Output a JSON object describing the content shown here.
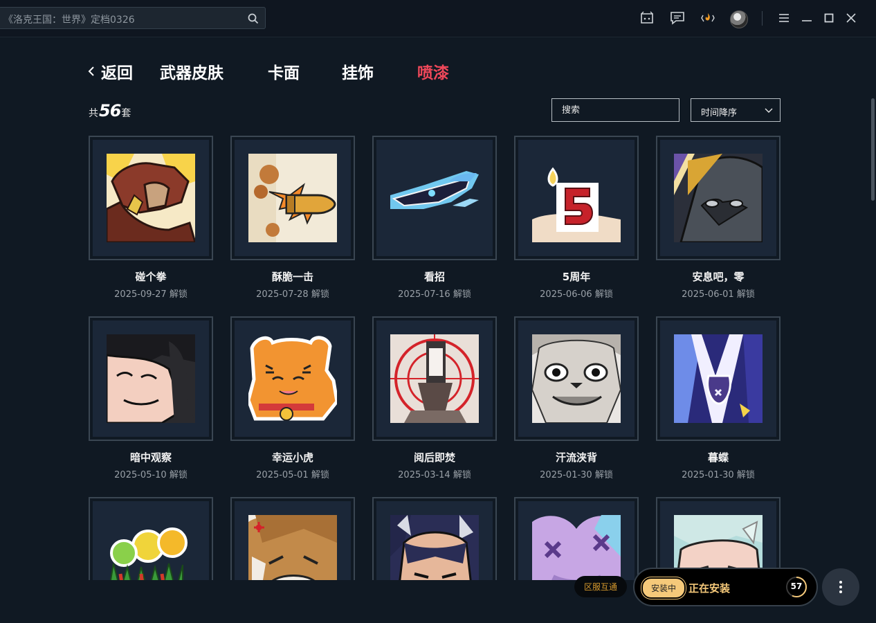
{
  "topbar": {
    "search_placeholder": "《洛克王国：世界》定档0326",
    "icons": [
      "search-icon",
      "gamepad-box-icon",
      "message-icon",
      "flame-icon",
      "avatar",
      "menu-icon",
      "minimize-icon",
      "maximize-icon",
      "close-icon"
    ]
  },
  "nav": {
    "back_label": "返回",
    "tabs": [
      {
        "label": "武器皮肤",
        "active": false
      },
      {
        "label": "卡面",
        "active": false
      },
      {
        "label": "挂饰",
        "active": false
      },
      {
        "label": "喷漆",
        "active": true
      }
    ]
  },
  "summary": {
    "prefix": "共",
    "count": "56",
    "suffix": "套"
  },
  "filters": {
    "search_placeholder": "搜索",
    "sort_label": "时间降序"
  },
  "items": [
    {
      "name": "碰个拳",
      "date": "2025-09-27 解锁",
      "art": "fist-bump"
    },
    {
      "name": "酥脆一击",
      "date": "2025-07-28 解锁",
      "art": "bullet"
    },
    {
      "name": "看招",
      "date": "2025-07-16 解锁",
      "art": "blade"
    },
    {
      "name": "5周年",
      "date": "2025-06-06 解锁",
      "art": "candle-five"
    },
    {
      "name": "安息吧，零",
      "date": "2025-06-01 解锁",
      "art": "hooded-face"
    },
    {
      "name": "暗中观察",
      "date": "2025-05-10 解锁",
      "art": "peeking-face"
    },
    {
      "name": "幸运小虎",
      "date": "2025-05-01 解锁",
      "art": "lucky-tiger"
    },
    {
      "name": "阅后即焚",
      "date": "2025-03-14 解锁",
      "art": "target-tower"
    },
    {
      "name": "汗流浃背",
      "date": "2025-01-30 解锁",
      "art": "sweating-seal"
    },
    {
      "name": "暮蝶",
      "date": "2025-01-30 解锁",
      "art": "butterfly"
    },
    {
      "name": "",
      "date": "",
      "art": "fruit-pile"
    },
    {
      "name": "",
      "date": "",
      "art": "angry-cat"
    },
    {
      "name": "",
      "date": "",
      "art": "horned-girl"
    },
    {
      "name": "",
      "date": "",
      "art": "purple-heart"
    },
    {
      "name": "",
      "date": "",
      "art": "pale-face"
    }
  ],
  "footer": {
    "region_label": "区服互通",
    "install_badge": "安装中",
    "install_text": "正在安装",
    "install_progress": "57",
    "install_progress_fraction": 0.57,
    "more_icon": "more-vertical-icon"
  },
  "colors": {
    "active_tab": "#f0485a",
    "install_accent": "#f5c97a",
    "region_text": "#d79a2d"
  }
}
